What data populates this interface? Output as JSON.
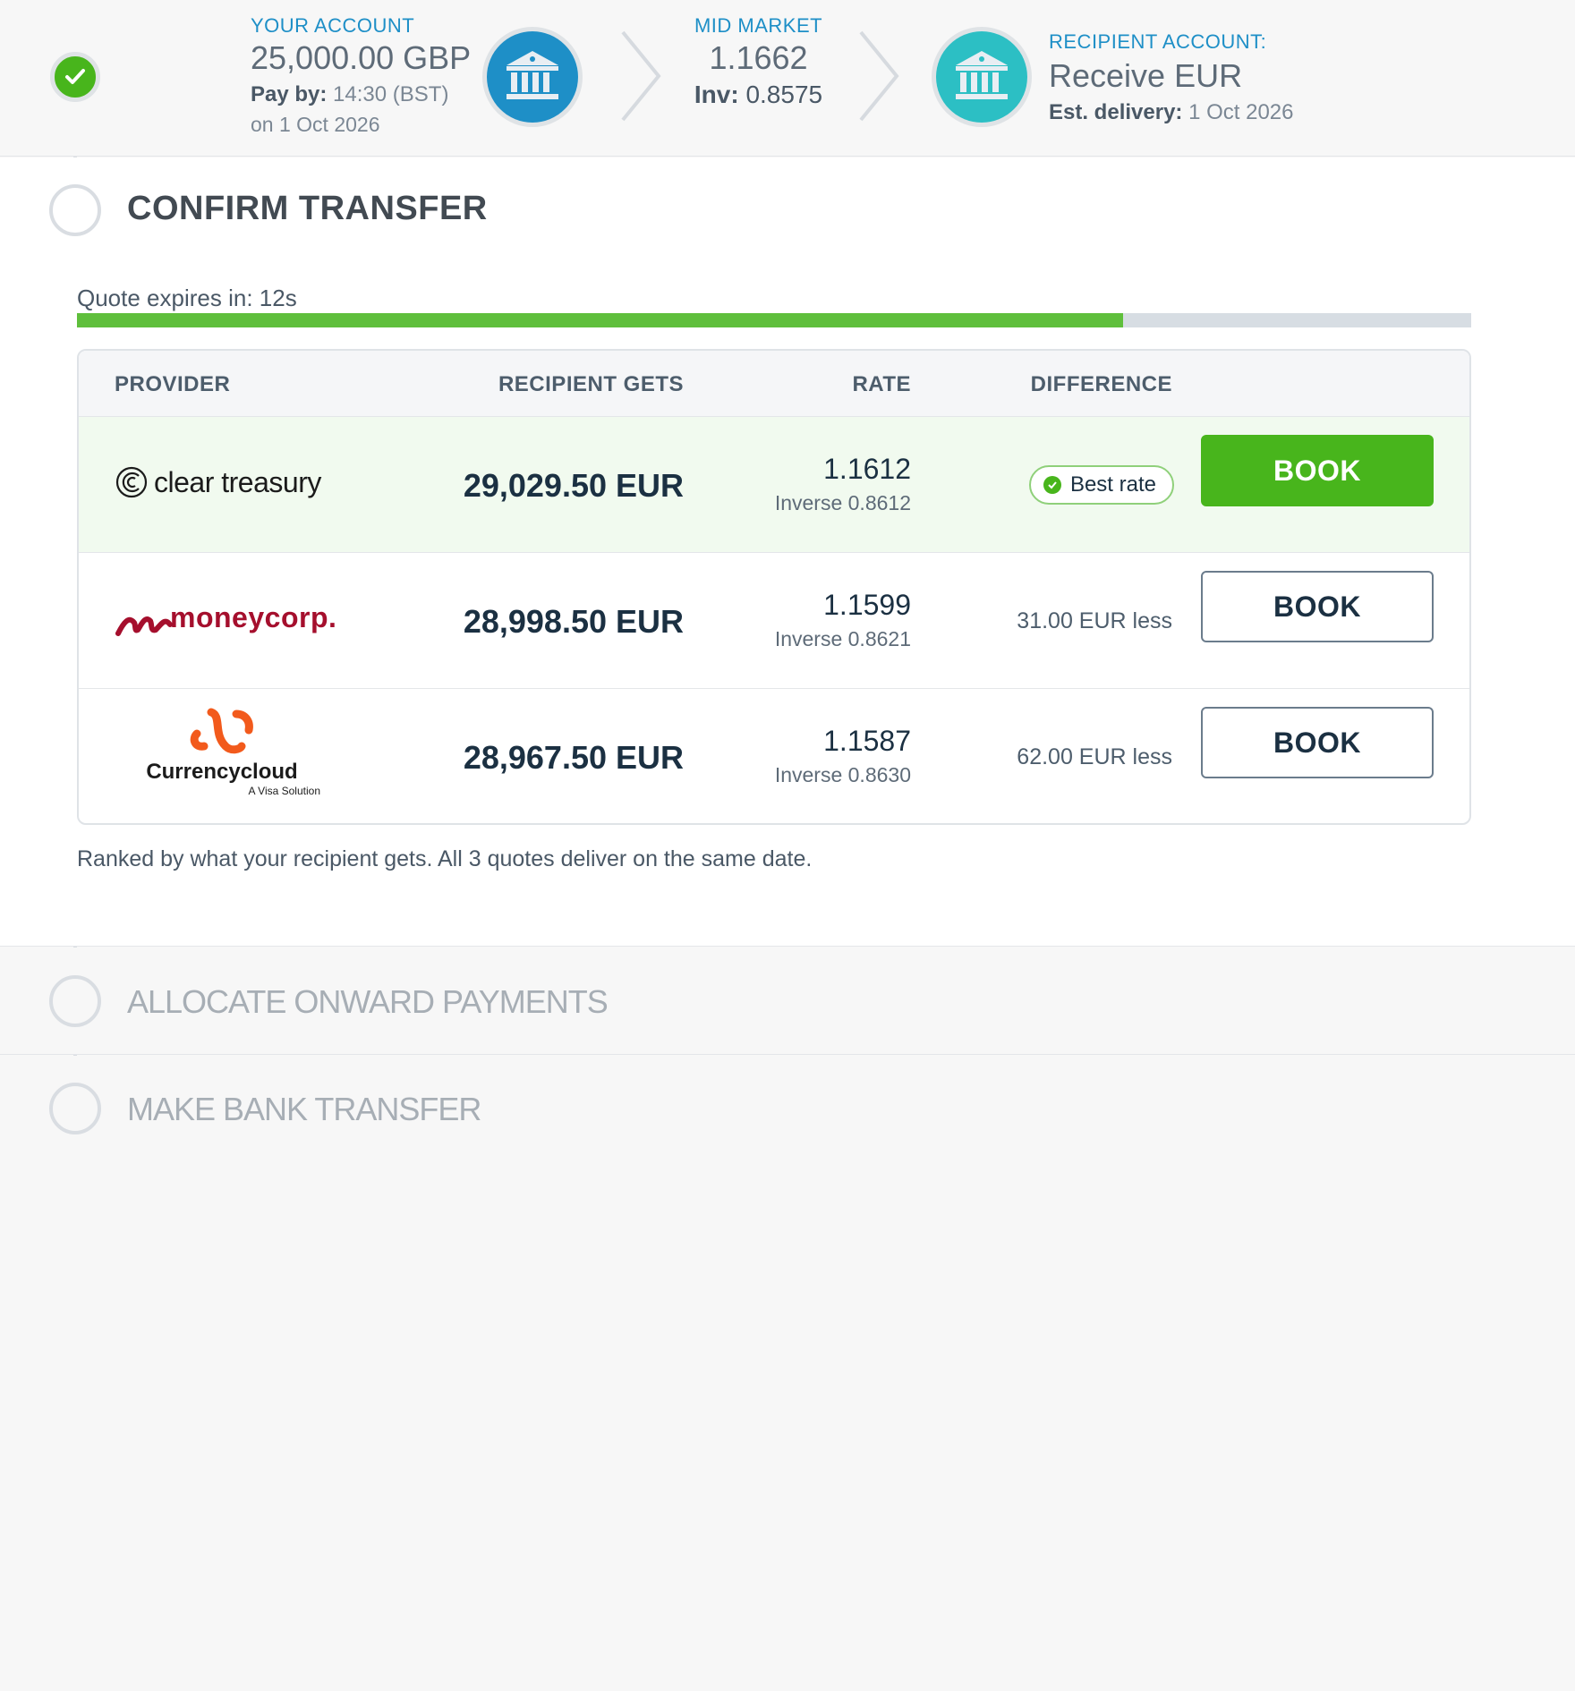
{
  "header": {
    "your_account": {
      "label": "YOUR ACCOUNT",
      "amount": "25,000.00 GBP",
      "pay_by_label": "Pay by:",
      "pay_by_time": "14:30 (BST)",
      "pay_by_date": "on 1 Oct 2026"
    },
    "mid_market": {
      "label": "MID MARKET",
      "rate": "1.1662",
      "inv_label": "Inv:",
      "inv_value": "0.8575"
    },
    "recipient": {
      "label": "RECIPIENT ACCOUNT:",
      "receive": "Receive EUR",
      "delivery_label": "Est. delivery:",
      "delivery_date": "1 Oct 2026"
    }
  },
  "confirm": {
    "title": "CONFIRM TRANSFER",
    "expires_text": "Quote expires in: 12s",
    "quote_progress_fraction": 0.75
  },
  "table": {
    "headers": {
      "provider": "PROVIDER",
      "recipient_gets": "RECIPIENT GETS",
      "rate": "RATE",
      "difference": "DIFFERENCE"
    },
    "rows": [
      {
        "provider": "clear treasury",
        "gets": "29,029.50 EUR",
        "rate": "1.1612",
        "inverse": "Inverse 0.8612",
        "difference": "Best rate",
        "book": "BOOK"
      },
      {
        "provider": "moneycorp.",
        "gets": "28,998.50 EUR",
        "rate": "1.1599",
        "inverse": "Inverse 0.8621",
        "difference": "31.00 EUR less",
        "book": "BOOK"
      },
      {
        "provider": "Currencycloud",
        "provider_sub": "A Visa Solution",
        "gets": "28,967.50 EUR",
        "rate": "1.1587",
        "inverse": "Inverse 0.8630",
        "difference": "62.00 EUR less",
        "book": "BOOK"
      }
    ]
  },
  "ranked_note": "Ranked by what your recipient gets. All 3 quotes deliver on the same date.",
  "steps": {
    "allocate": "ALLOCATE ONWARD PAYMENTS",
    "bank_transfer": "MAKE BANK TRANSFER"
  },
  "colors": {
    "accent_green": "#48b51c",
    "label_blue": "#1e8fc7",
    "bank_blue": "#1e8fc7",
    "bank_teal": "#2cbfc4",
    "moneycorp_red": "#a50f2d",
    "currencycloud_orange": "#f25a1c"
  },
  "icons": {
    "step1": "checkmark-icon",
    "source_bank": "bank-icon",
    "recipient_bank": "bank-icon",
    "flow": "chevron-right-icon"
  }
}
